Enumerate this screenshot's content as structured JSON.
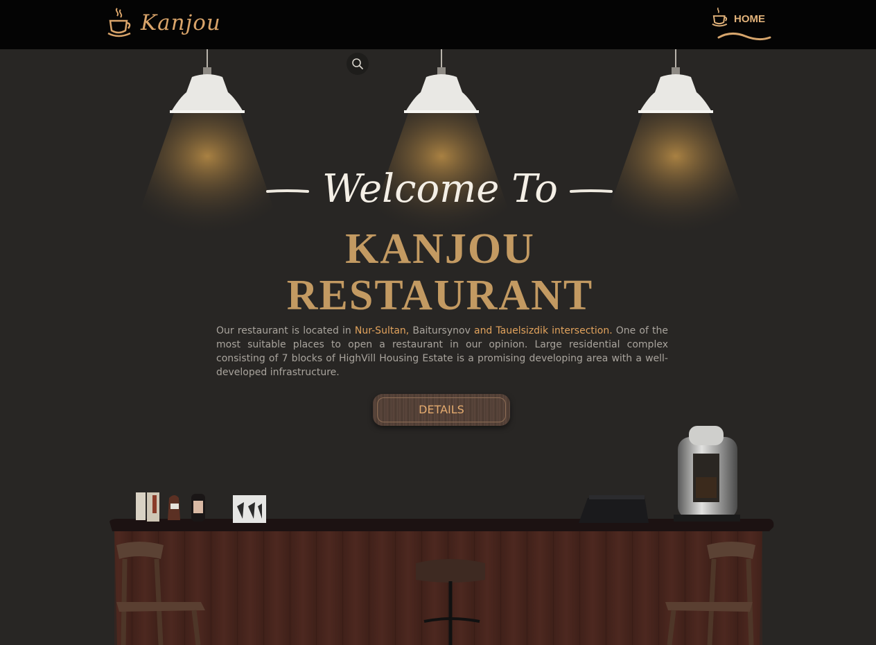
{
  "nav": {
    "brand": "Kanjou",
    "home_label": "HOME",
    "brand_icon": "coffee-cup-icon",
    "home_icon": "coffee-cup-icon"
  },
  "search": {
    "icon": "search-icon"
  },
  "hero": {
    "welcome": "Welcome To",
    "title_line1": "KANJOU",
    "title_line2": "RESTAURANT",
    "desc": {
      "p1": "Our restaurant is located in ",
      "hl1": "Nur-Sultan,",
      "p2": " Baitursynov ",
      "hl2": "and Tauelsizdik intersection.",
      "p3": " One of the most suitable places to open a restaurant in our opinion. Large residential complex consisting of 7 blocks of HighVill Housing Estate is a promising developing area with a well-developed infrastructure."
    },
    "button_label": "DETAILS"
  },
  "colors": {
    "background": "#282624",
    "topbar": "#040404",
    "accent": "#c39a62",
    "highlight": "#e2a35d",
    "welcome_text": "#f4efe6"
  }
}
